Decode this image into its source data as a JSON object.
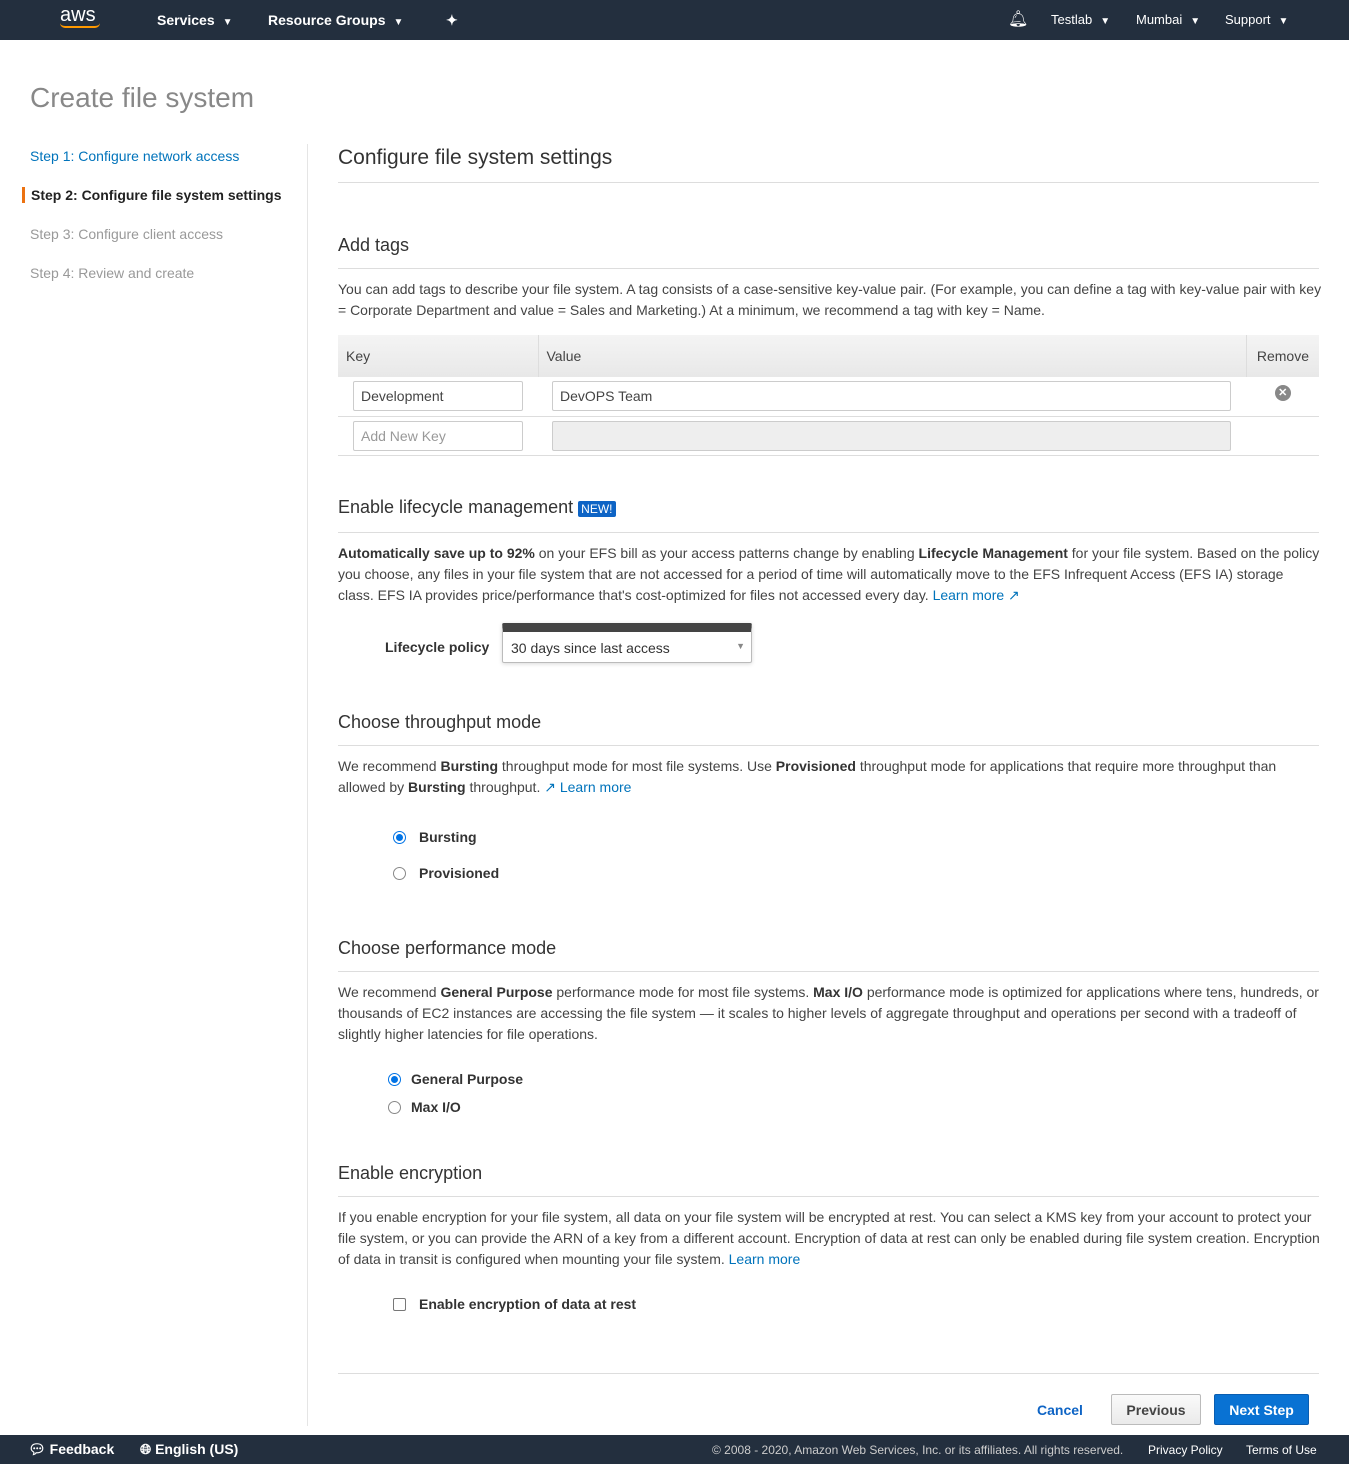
{
  "nav": {
    "logo": "aws",
    "services": "Services",
    "resource_groups": "Resource Groups",
    "account": "Testlab",
    "region": "Mumbai",
    "support": "Support"
  },
  "page_title": "Create file system",
  "steps": [
    "Step 1: Configure network access",
    "Step 2: Configure file system settings",
    "Step 3: Configure client access",
    "Step 4: Review and create"
  ],
  "section_title": "Configure file system settings",
  "tags": {
    "title": "Add tags",
    "description": "You can add tags to describe your file system. A tag consists of a case-sensitive key-value pair. (For example, you can define a tag with key-value pair with key = Corporate Department and value = Sales and Marketing.) At a minimum, we recommend a tag with key = Name.",
    "headers": {
      "key": "Key",
      "value": "Value",
      "remove": "Remove"
    },
    "rows": [
      {
        "key": "Development",
        "value": "DevOPS Team"
      }
    ],
    "new_key_placeholder": "Add New Key"
  },
  "lifecycle": {
    "title": "Enable lifecycle management",
    "badge": "NEW!",
    "bold1": "Automatically save up to 92%",
    "text1": " on your EFS bill as your access patterns change by enabling ",
    "bold2": "Lifecycle Management",
    "text2": " for your file system. Based on the policy you choose, any files in your file system that are not accessed for a period of time will automatically move to the EFS Infrequent Access (EFS IA) storage class. EFS IA provides price/performance that's cost-optimized for files not accessed every day. ",
    "learn_more": "Learn more",
    "policy_label": "Lifecycle policy",
    "policy_value": "30 days since last access"
  },
  "throughput": {
    "title": "Choose throughput mode",
    "t1": "We recommend ",
    "b1": "Bursting",
    "t2": " throughput mode for most file systems. Use ",
    "b2": "Provisioned",
    "t3": " throughput mode for applications that require more throughput than allowed by ",
    "b3": "Bursting",
    "t4": " throughput. ",
    "learn_more": "Learn more",
    "options": [
      "Bursting",
      "Provisioned"
    ],
    "selected": "Bursting"
  },
  "performance": {
    "title": "Choose performance mode",
    "t1": "We recommend ",
    "b1": "General Purpose",
    "t2": " performance mode for most file systems. ",
    "b2": "Max I/O",
    "t3": " performance mode is optimized for applications where tens, hundreds, or thousands of EC2 instances are accessing the file system — it scales to higher levels of aggregate throughput and operations per second with a tradeoff of slightly higher latencies for file operations.",
    "options": [
      "General Purpose",
      "Max I/O"
    ],
    "selected": "General Purpose"
  },
  "encryption": {
    "title": "Enable encryption",
    "text": "If you enable encryption for your file system, all data on your file system will be encrypted at rest. You can select a KMS key from your account to protect your file system, or you can provide the ARN of a key from a different account. Encryption of data at rest can only be enabled during file system creation. Encryption of data in transit is configured when mounting your file system. ",
    "learn_more": "Learn more",
    "checkbox_label": "Enable encryption of data at rest",
    "checked": false
  },
  "actions": {
    "cancel": "Cancel",
    "previous": "Previous",
    "next": "Next Step"
  },
  "footer": {
    "feedback": "Feedback",
    "language": "English (US)",
    "copyright": "© 2008 - 2020, Amazon Web Services, Inc. or its affiliates. All rights reserved.",
    "privacy": "Privacy Policy",
    "terms": "Terms of Use"
  },
  "colors": {
    "nav_bg": "#232f3e",
    "link": "#0073bb",
    "primary": "#0972d3",
    "active_step": "#ec7211"
  }
}
